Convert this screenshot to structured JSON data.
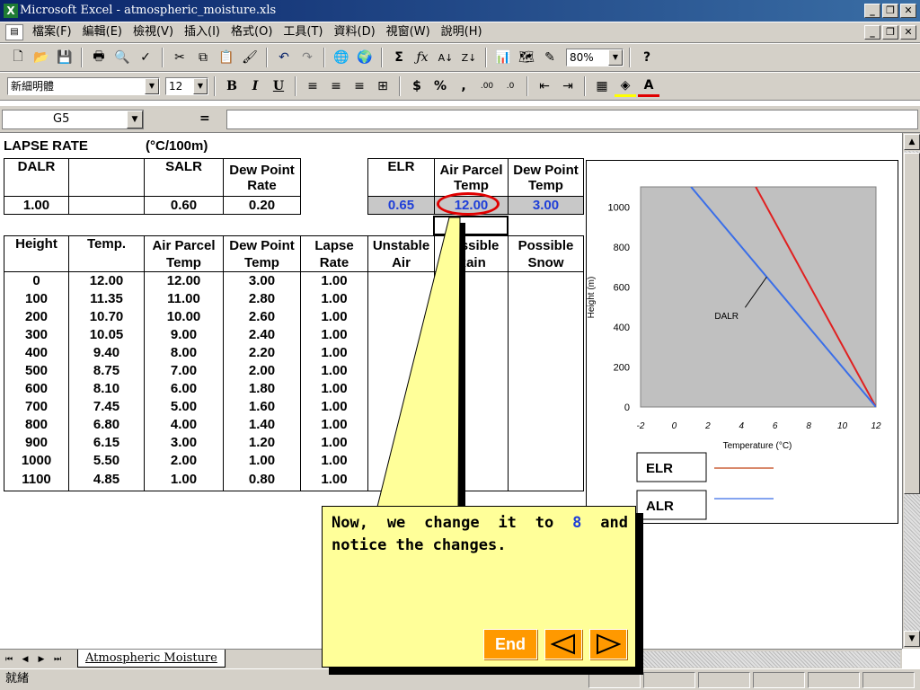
{
  "window": {
    "title": "Microsoft Excel - atmospheric_moisture.xls",
    "controls": [
      "_",
      "❐",
      "✕"
    ]
  },
  "menu": [
    "檔案(F)",
    "編輯(E)",
    "檢視(V)",
    "插入(I)",
    "格式(O)",
    "工具(T)",
    "資料(D)",
    "視窗(W)",
    "說明(H)"
  ],
  "toolbar": {
    "zoom": "80%",
    "font_name": "新細明體",
    "font_size": "12"
  },
  "formula_bar": {
    "name_box": "G5",
    "equals": "=",
    "content": ""
  },
  "sheet": {
    "caption": "LAPSE RATE",
    "caption_unit": "(°C/100m)",
    "top_headers": {
      "dalr": "DALR",
      "salr": "SALR",
      "dew_rate": "Dew Point Rate",
      "elr": "ELR",
      "air_parcel": "Air Parcel Temp",
      "dew_point": "Dew Point Temp"
    },
    "top_values": {
      "dalr": "1.00",
      "salr": "0.60",
      "dew_rate": "0.20",
      "elr": "0.65",
      "air_parcel": "12.00",
      "dew_point": "3.00"
    },
    "col_headers": [
      "Height",
      "Temp.",
      "Air Parcel Temp",
      "Dew Point Temp",
      "Lapse Rate",
      "Unstable Air",
      "Possible Rain",
      "Possible Snow"
    ],
    "rows": [
      [
        "0",
        "12.00",
        "12.00",
        "3.00",
        "1.00"
      ],
      [
        "100",
        "11.35",
        "11.00",
        "2.80",
        "1.00"
      ],
      [
        "200",
        "10.70",
        "10.00",
        "2.60",
        "1.00"
      ],
      [
        "300",
        "10.05",
        "9.00",
        "2.40",
        "1.00"
      ],
      [
        "400",
        "9.40",
        "8.00",
        "2.20",
        "1.00"
      ],
      [
        "500",
        "8.75",
        "7.00",
        "2.00",
        "1.00"
      ],
      [
        "600",
        "8.10",
        "6.00",
        "1.80",
        "1.00"
      ],
      [
        "700",
        "7.45",
        "5.00",
        "1.60",
        "1.00"
      ],
      [
        "800",
        "6.80",
        "4.00",
        "1.40",
        "1.00"
      ],
      [
        "900",
        "6.15",
        "3.00",
        "1.20",
        "1.00"
      ],
      [
        "1000",
        "5.50",
        "2.00",
        "1.00",
        "1.00"
      ],
      [
        "1100",
        "4.85",
        "1.00",
        "0.80",
        "1.00"
      ]
    ],
    "tab_name": "Atmospheric Moisture"
  },
  "chart_data": {
    "type": "line",
    "xlabel": "Temperature (°C)",
    "ylabel": "Height (m)",
    "xlim": [
      -2,
      12
    ],
    "ylim": [
      0,
      1100
    ],
    "x_ticks": [
      "-2",
      "0",
      "2",
      "4",
      "6",
      "8",
      "10",
      "12"
    ],
    "y_ticks": [
      "0",
      "200",
      "400",
      "600",
      "800",
      "1000"
    ],
    "annotation": "DALR",
    "series": [
      {
        "name": "ELR",
        "color": "#e02020",
        "x": [
          12,
          4.85
        ],
        "y": [
          0,
          1100
        ]
      },
      {
        "name": "ALR",
        "color": "#3a6ee8",
        "x": [
          12,
          1
        ],
        "y": [
          0,
          1100
        ]
      }
    ],
    "legend": [
      {
        "label": "ELR",
        "color": "#c04010"
      },
      {
        "label": "ALR",
        "color": "#3a6ee8"
      }
    ],
    "legend_position": "bottom",
    "plot_background": "#c0c0c0"
  },
  "callout": {
    "text_before": "Now, we change it to ",
    "highlight": "8",
    "text_after": " and notice the changes.",
    "end_label": "End",
    "highlight_color": "#1f3fd8",
    "button_color": "#ff9900"
  },
  "status": {
    "text": "就緒"
  }
}
